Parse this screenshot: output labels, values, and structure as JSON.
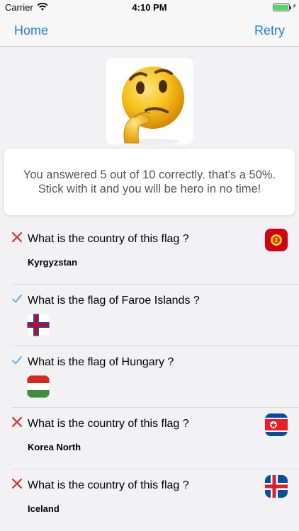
{
  "status": {
    "carrier": "Carrier",
    "time": "4:10 PM"
  },
  "nav": {
    "home": "Home",
    "retry": "Retry"
  },
  "result": {
    "message": "You answered 5 out of 10 correctly. that's a 50%. Stick with it and you will be hero in no time!"
  },
  "colors": {
    "accent": "#1a7fd4",
    "wrong": "#d32f2f",
    "correct": "#5aa9e6"
  },
  "questions": [
    {
      "text": "What is the country of this flag ?",
      "answer": "Kyrgyzstan",
      "correct": false,
      "flag_icon": "kyrgyzstan-flag-icon"
    },
    {
      "text": "What is the flag of Faroe Islands ?",
      "answer": "",
      "correct": true,
      "flag_icon": "faroe-islands-flag-icon"
    },
    {
      "text": "What is the flag of Hungary ?",
      "answer": "",
      "correct": true,
      "flag_icon": "hungary-flag-icon"
    },
    {
      "text": "What is the country of this flag ?",
      "answer": "Korea North",
      "correct": false,
      "flag_icon": "north-korea-flag-icon"
    },
    {
      "text": "What is the country of this flag ?",
      "answer": "Iceland",
      "correct": false,
      "flag_icon": "iceland-flag-icon"
    }
  ]
}
